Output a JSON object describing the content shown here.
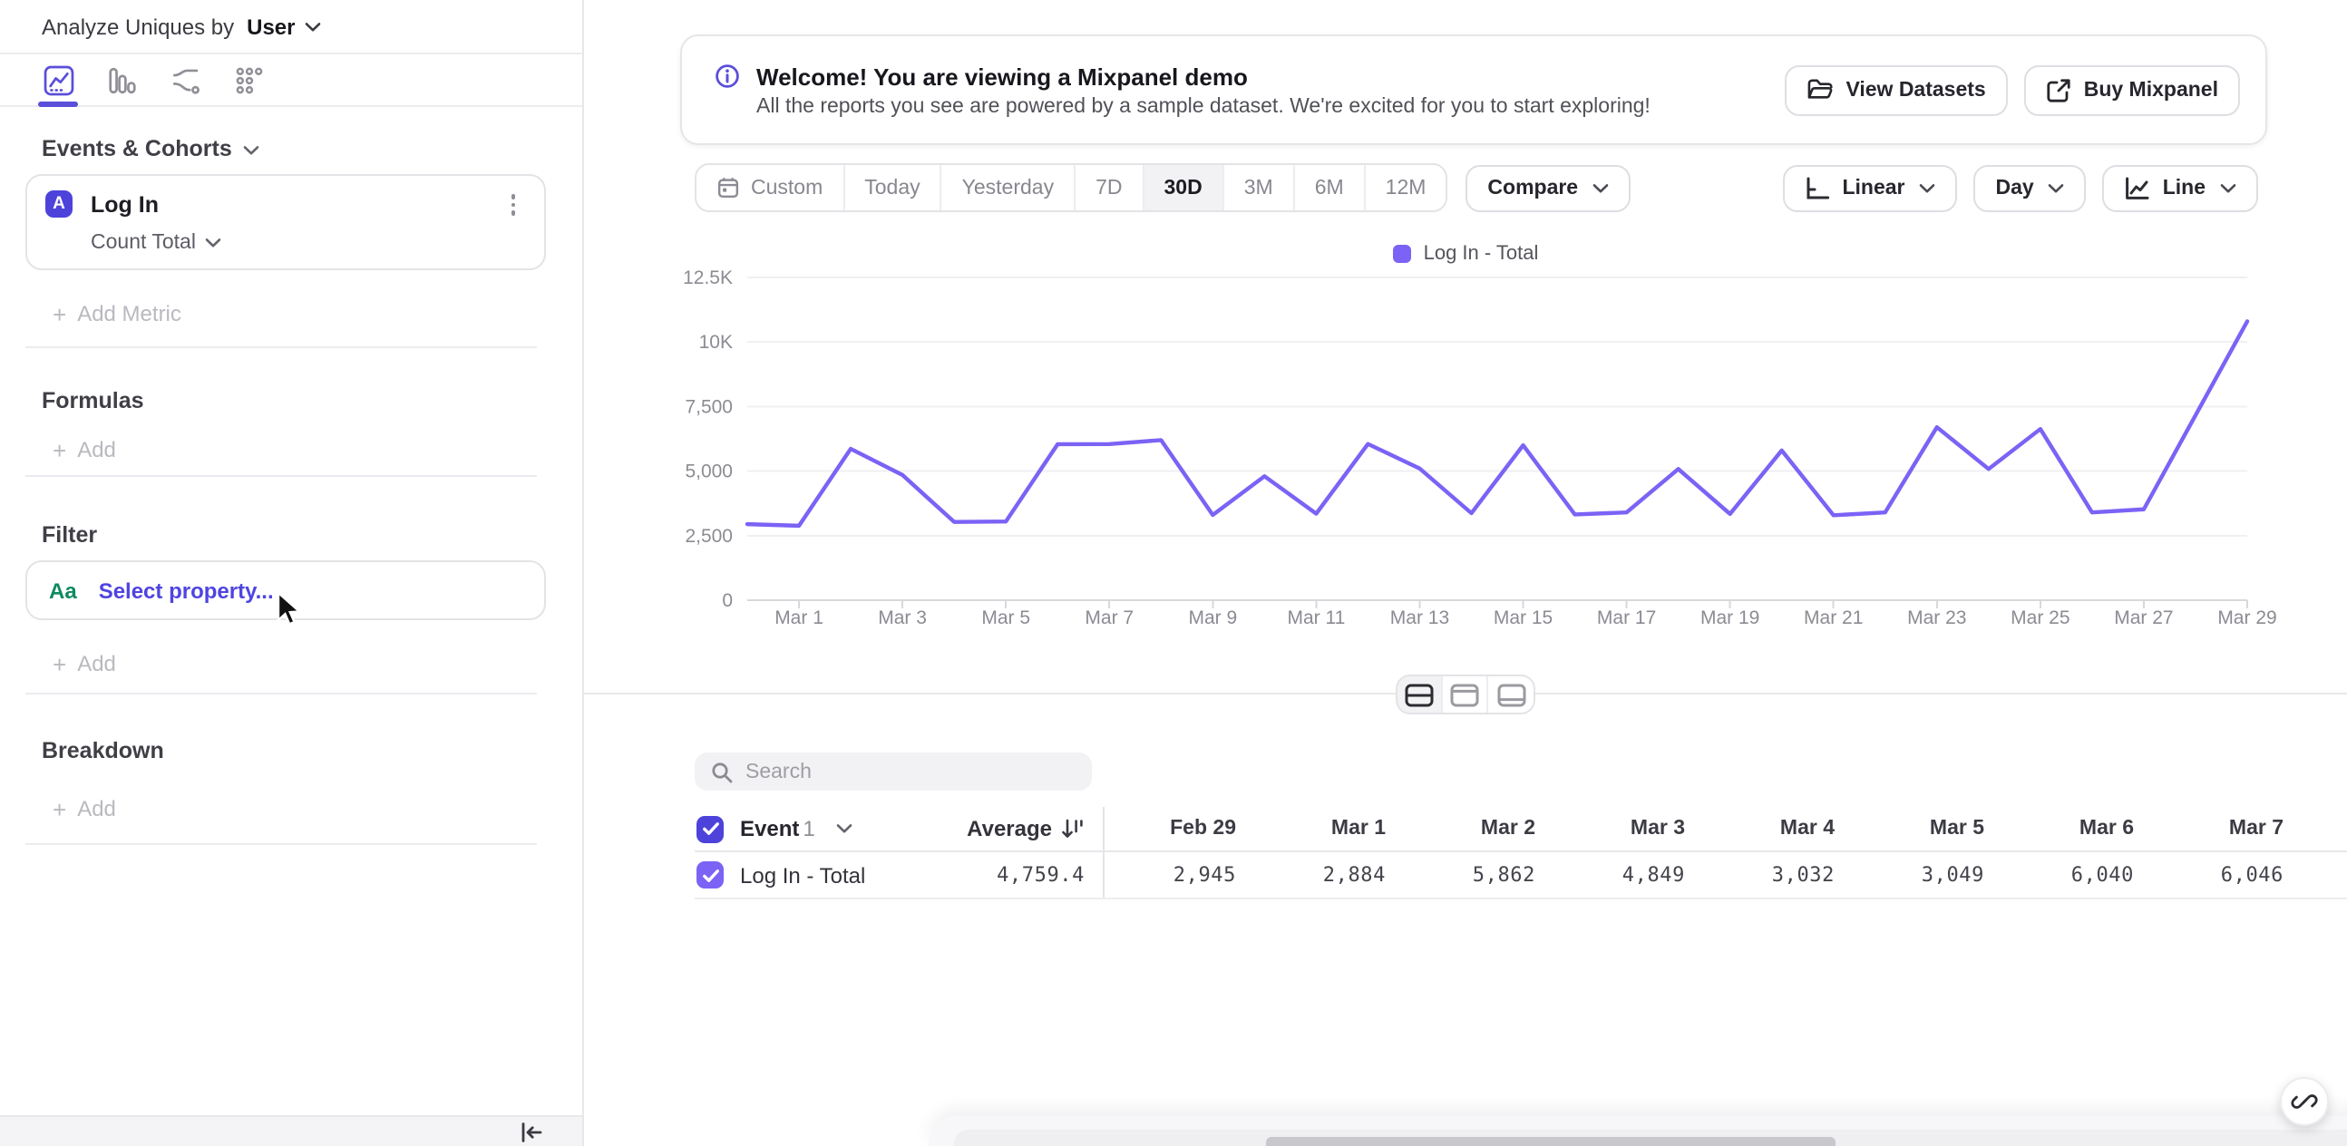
{
  "colors": {
    "accent_indigo": "#4D43DB",
    "series_purple": "#7C62F5",
    "selected_tab_purple": "#5B4FD9",
    "link_purple": "#4F44E0",
    "property_green": "#0E8A5F"
  },
  "sidebar": {
    "analyze_prefix": "Analyze Uniques by",
    "analyze_value": "User",
    "tab_icons": [
      "insights-line-tab",
      "bar-chart-tab",
      "flows-tab",
      "retention-tab"
    ],
    "events_cohorts_label": "Events & Cohorts",
    "metric_card": {
      "badge": "A",
      "event": "Log In",
      "aggregation": "Count Total"
    },
    "add_metric_label": "Add Metric",
    "formulas_label": "Formulas",
    "filter_label": "Filter",
    "breakdown_label": "Breakdown",
    "add_label": "Add",
    "filter_property": {
      "type_badge": "Aa",
      "placeholder": "Select property..."
    }
  },
  "banner": {
    "title": "Welcome! You are viewing a Mixpanel demo",
    "subtitle": "All the reports you see are powered by a sample dataset. We're excited for you to start exploring!",
    "view_datasets_label": "View Datasets",
    "buy_mixpanel_label": "Buy Mixpanel"
  },
  "toolbar": {
    "ranges": [
      "Custom",
      "Today",
      "Yesterday",
      "7D",
      "30D",
      "3M",
      "6M",
      "12M"
    ],
    "active_range": "30D",
    "compare_label": "Compare",
    "scale_label": "Linear",
    "interval_label": "Day",
    "chart_type_label": "Line"
  },
  "chart_data": {
    "type": "line",
    "title": "",
    "x": [
      "Feb 29",
      "Mar 1",
      "Mar 2",
      "Mar 3",
      "Mar 4",
      "Mar 5",
      "Mar 6",
      "Mar 7",
      "Mar 8",
      "Mar 9",
      "Mar 10",
      "Mar 11",
      "Mar 12",
      "Mar 13",
      "Mar 14",
      "Mar 15",
      "Mar 16",
      "Mar 17",
      "Mar 18",
      "Mar 19",
      "Mar 20",
      "Mar 21",
      "Mar 22",
      "Mar 23",
      "Mar 24",
      "Mar 25",
      "Mar 26",
      "Mar 27",
      "Mar 28",
      "Mar 29"
    ],
    "series": [
      {
        "name": "Log In - Total",
        "color": "#7C62F5",
        "values": [
          2945,
          2884,
          5862,
          4849,
          3032,
          3049,
          6040,
          6046,
          6200,
          3300,
          4800,
          3350,
          6050,
          5100,
          3370,
          6000,
          3320,
          3400,
          5080,
          3340,
          5800,
          3290,
          3400,
          6700,
          5080,
          6630,
          3400,
          3520,
          7160,
          10800
        ]
      }
    ],
    "xlabel": "",
    "ylabel": "",
    "ylim": [
      0,
      12500
    ],
    "y_ticks": [
      0,
      2500,
      5000,
      7500,
      10000,
      12500
    ],
    "y_tick_labels": [
      "0",
      "2,500",
      "5,000",
      "7,500",
      "10K",
      "12.5K"
    ],
    "x_tick_every": 2,
    "grid": "horizontal",
    "legend": {
      "position": "top-center",
      "label": "Log In - Total"
    }
  },
  "table": {
    "search_placeholder": "Search",
    "event_column": {
      "label": "Event",
      "count": "1"
    },
    "average_label": "Average",
    "date_columns": [
      "Feb 29",
      "Mar 1",
      "Mar 2",
      "Mar 3",
      "Mar 4",
      "Mar 5",
      "Mar 6",
      "Mar 7"
    ],
    "row": {
      "name": "Log In - Total",
      "average": "4,759.4",
      "values": [
        "2,945",
        "2,884",
        "5,862",
        "4,849",
        "3,032",
        "3,049",
        "6,040",
        "6,046"
      ]
    }
  }
}
